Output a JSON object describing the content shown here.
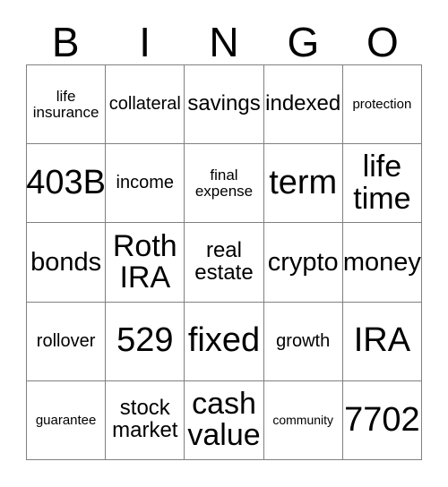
{
  "card": {
    "header_letters": [
      "B",
      "I",
      "N",
      "G",
      "O"
    ],
    "columns": 5,
    "rows": 5,
    "border_color": "#808080",
    "text_color": "#000000",
    "background_color": "#ffffff",
    "cells": [
      [
        {
          "text": "life\ninsurance",
          "size": "smd"
        },
        {
          "text": "collateral",
          "size": "md"
        },
        {
          "text": "savings",
          "size": "lg"
        },
        {
          "text": "indexed",
          "size": "lg"
        },
        {
          "text": "protection",
          "size": "sm"
        }
      ],
      [
        {
          "text": "403B",
          "size": "huge"
        },
        {
          "text": "income",
          "size": "md"
        },
        {
          "text": "final\nexpense",
          "size": "smd"
        },
        {
          "text": "term",
          "size": "huge"
        },
        {
          "text": "life\ntime",
          "size": "xxl"
        }
      ],
      [
        {
          "text": "bonds",
          "size": "xl"
        },
        {
          "text": "Roth\nIRA",
          "size": "xxl"
        },
        {
          "text": "real\nestate",
          "size": "lg"
        },
        {
          "text": "crypto",
          "size": "xl"
        },
        {
          "text": "money",
          "size": "xl"
        }
      ],
      [
        {
          "text": "rollover",
          "size": "md"
        },
        {
          "text": "529",
          "size": "huge"
        },
        {
          "text": "fixed",
          "size": "huge"
        },
        {
          "text": "growth",
          "size": "md"
        },
        {
          "text": "IRA",
          "size": "huge"
        }
      ],
      [
        {
          "text": "guarantee",
          "size": "sm"
        },
        {
          "text": "stock\nmarket",
          "size": "lg"
        },
        {
          "text": "cash\nvalue",
          "size": "xxl"
        },
        {
          "text": "community",
          "size": "xs"
        },
        {
          "text": "7702",
          "size": "huge"
        }
      ]
    ]
  }
}
